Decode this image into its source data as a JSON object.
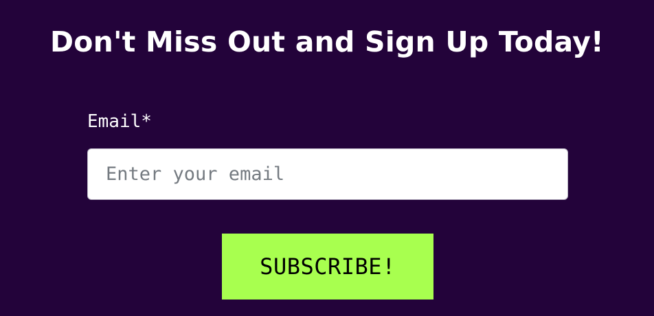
{
  "signup": {
    "headline": "Don't Miss Out and Sign Up Today!",
    "email_label": "Email*",
    "email_placeholder": "Enter your email",
    "email_value": "",
    "subscribe_label": "SUBSCRIBE!"
  },
  "colors": {
    "background": "#23033a",
    "headline_text": "#ffffff",
    "button_background": "#a8ff4f",
    "button_text": "#000000",
    "input_background": "#ffffff",
    "placeholder_text": "#747a80"
  }
}
